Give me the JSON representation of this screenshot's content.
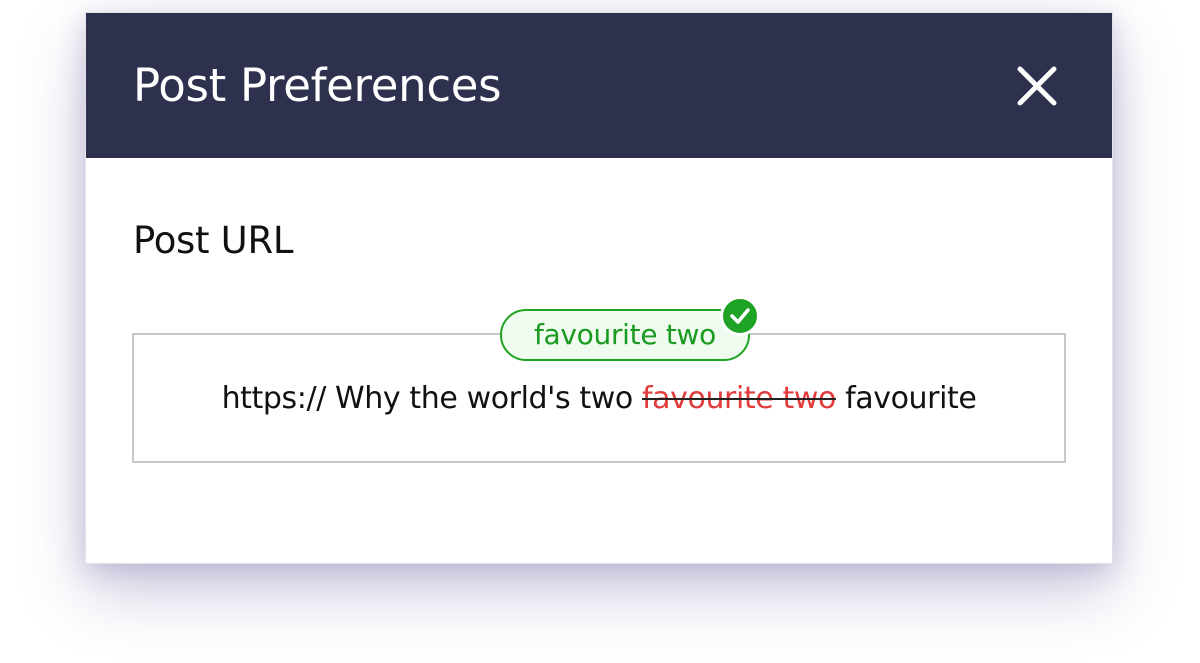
{
  "dialog": {
    "title": "Post Preferences",
    "close_icon": "close-icon"
  },
  "post_url": {
    "label": "Post URL",
    "prefix": "https:// Why the world's two ",
    "removed": "favourite two",
    "suffix": " favourite",
    "suggestion": "favourite two",
    "suggestion_icon": "check-circle-icon"
  },
  "colors": {
    "header_bg": "#2e314e",
    "accent_green": "#1fa324",
    "removed_red": "#e23b3b"
  }
}
